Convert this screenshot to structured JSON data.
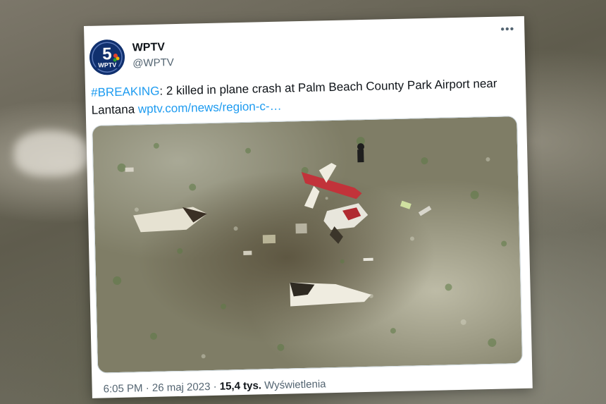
{
  "tweet": {
    "author_name": "WPTV",
    "author_handle": "@WPTV",
    "avatar_text": "WPTV",
    "avatar_number": "5",
    "hashtag": "#BREAKING",
    "text_main": ": 2 killed in plane crash at Palm Beach County Park Airport near Lantana ",
    "link": "wptv.com/news/region-c-…",
    "time": "6:05 PM",
    "date": "26 maj 2023",
    "separator": "·",
    "views_count": "15,4 tys.",
    "views_label": "Wyświetlenia"
  },
  "icons": {
    "more": "more-options-icon",
    "avatar": "wptv-logo"
  },
  "colors": {
    "link": "#1d9bf0",
    "text": "#0f1419",
    "secondary": "#536471",
    "avatar_bg": "#10306e"
  }
}
